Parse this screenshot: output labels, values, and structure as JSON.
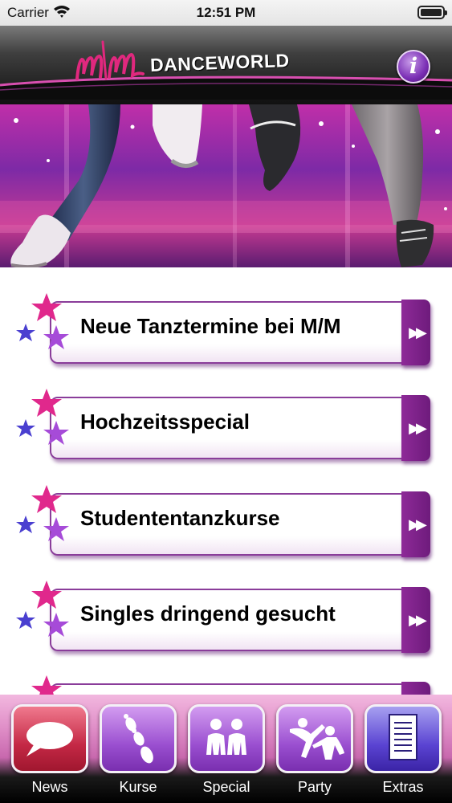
{
  "status_bar": {
    "carrier": "Carrier",
    "time": "12:51 PM"
  },
  "header": {
    "brand": "DANCEWORLD",
    "logo_icon": "mm-logo",
    "info_label": "i"
  },
  "hero": {
    "image": "dancing-legs-photo"
  },
  "list": {
    "items": [
      {
        "label": "Neue Tanztermine bei M/M"
      },
      {
        "label": "Hochzeitsspecial"
      },
      {
        "label": "Studententanzkurse"
      },
      {
        "label": "Singles dringend gesucht"
      },
      {
        "label": ""
      }
    ],
    "arrow_glyph": "▶▶"
  },
  "tabs": [
    {
      "label": "News",
      "icon": "speech-bubble-icon"
    },
    {
      "label": "Kurse",
      "icon": "footprints-icon"
    },
    {
      "label": "Special",
      "icon": "couple-icon"
    },
    {
      "label": "Party",
      "icon": "dancers-icon"
    },
    {
      "label": "Extras",
      "icon": "document-icon"
    }
  ],
  "colors": {
    "accent": "#8a3d9a",
    "star_pink": "#e0288c",
    "star_purple": "#a64bd8",
    "star_blue": "#4a3fd0"
  }
}
